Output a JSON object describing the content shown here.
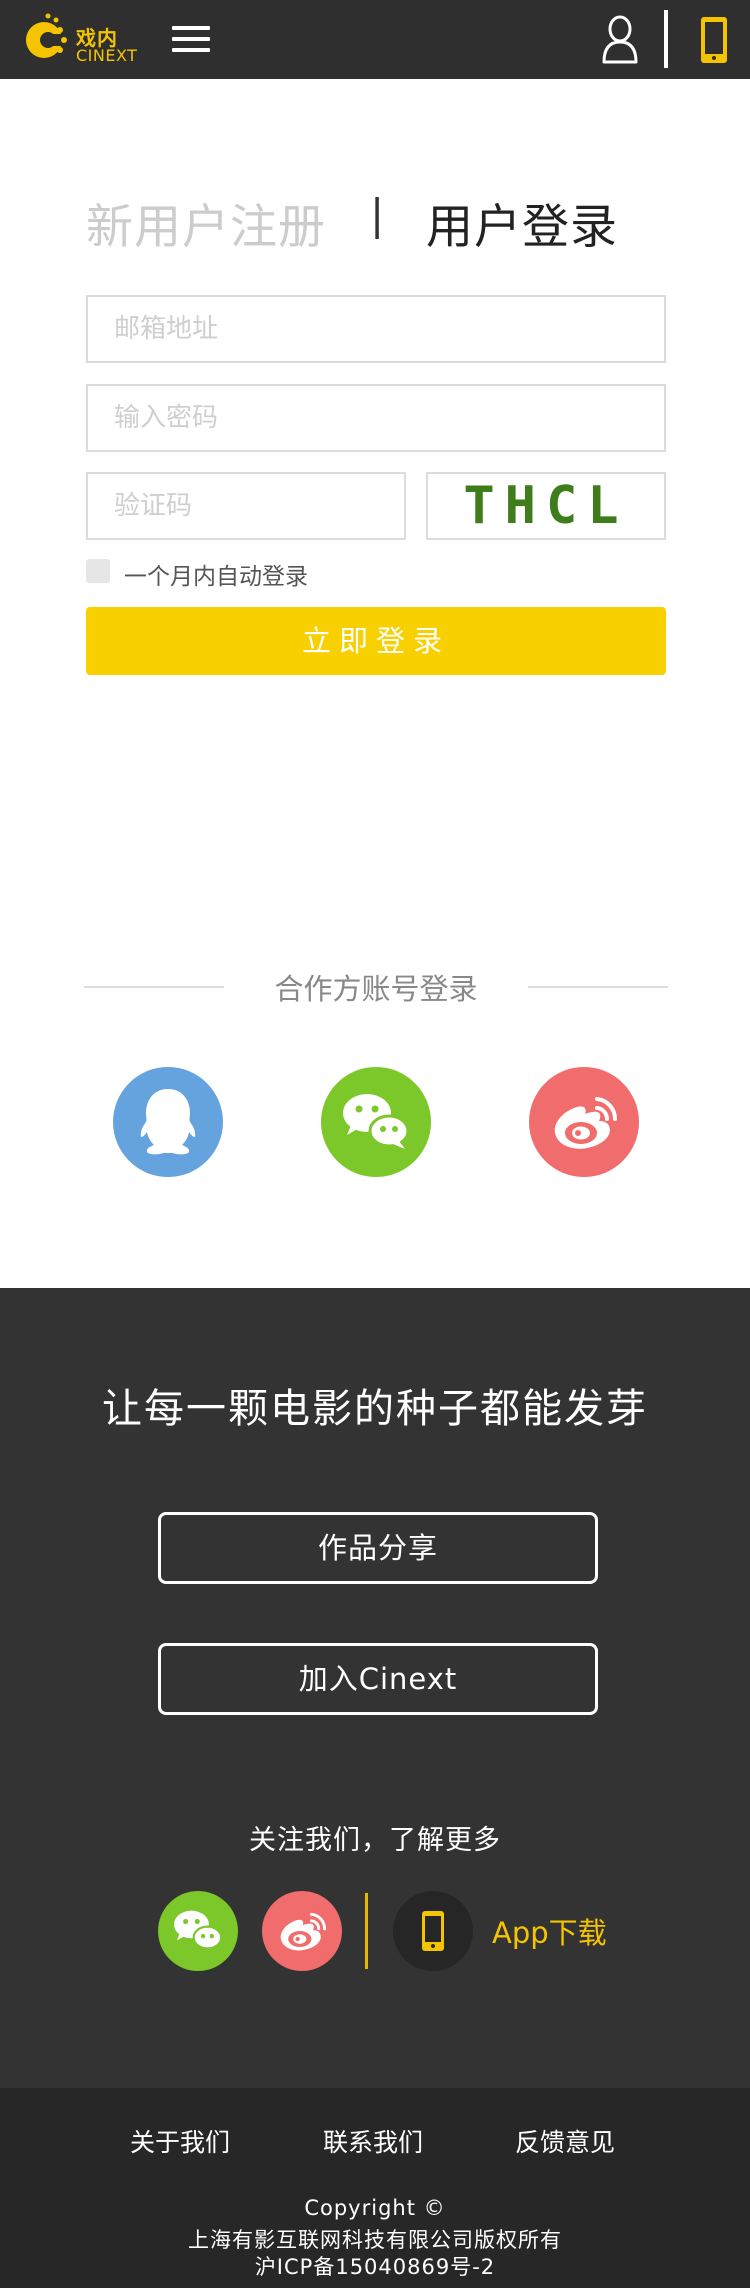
{
  "header": {
    "logo_cn": "戏内",
    "logo_en": "CINEXT",
    "icons": [
      "menu-icon",
      "user-icon",
      "phone-icon"
    ],
    "accent_color": "#f5c400"
  },
  "tabs": {
    "register": "新用户注册",
    "separator": "|",
    "login": "用户登录"
  },
  "form": {
    "email_placeholder": "邮箱地址",
    "email_value": "",
    "password_placeholder": "输入密码",
    "password_value": "",
    "captcha_placeholder": "验证码",
    "captcha_value": "",
    "captcha_image_text": "THCL",
    "remember_label": "一个月内自动登录",
    "remember_checked": false,
    "submit_label": "立即登录",
    "submit_color": "#f8d000"
  },
  "partner": {
    "title": "合作方账号登录",
    "providers": [
      {
        "name": "QQ",
        "icon": "qq-icon",
        "color": "#65a3df"
      },
      {
        "name": "WeChat",
        "icon": "wechat-icon",
        "color": "#7cc72a"
      },
      {
        "name": "Weibo",
        "icon": "weibo-icon",
        "color": "#f16c6c"
      }
    ]
  },
  "promo": {
    "slogan": "让每一颗电影的种子都能发芽",
    "share_button": "作品分享",
    "join_button": "加入Cinext",
    "follow_text": "关注我们，了解更多",
    "app_download": "App下载"
  },
  "footer": {
    "links": {
      "about": "关于我们",
      "contact": "联系我们",
      "feedback": "反馈意见"
    },
    "copyright": "Copyright ©",
    "company": "上海有影互联网科技有限公司版权所有",
    "icp": "沪ICP备15040869号-2"
  }
}
